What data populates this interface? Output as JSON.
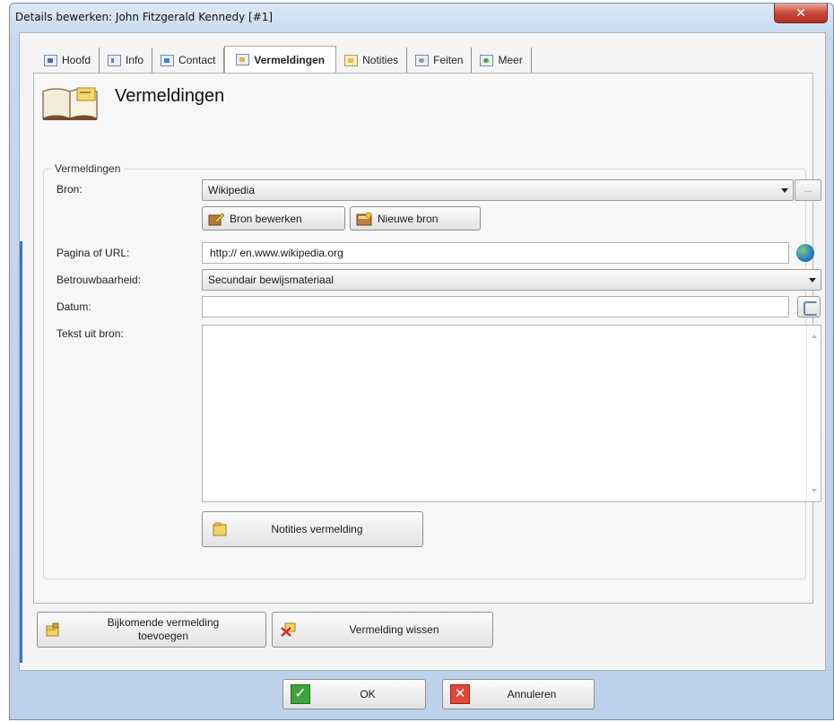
{
  "window": {
    "title": "Details bewerken: John Fitzgerald Kennedy [#1]",
    "close_glyph": "✕"
  },
  "tabs": [
    {
      "label": "Hoofd",
      "icon": "person-card-icon"
    },
    {
      "label": "Info",
      "icon": "info-icon"
    },
    {
      "label": "Contact",
      "icon": "house-icon"
    },
    {
      "label": "Vermeldingen",
      "icon": "citation-icon",
      "active": true
    },
    {
      "label": "Notities",
      "icon": "note-icon"
    },
    {
      "label": "Feiten",
      "icon": "facts-icon"
    },
    {
      "label": "Meer",
      "icon": "more-icon"
    }
  ],
  "page": {
    "heading": "Vermeldingen",
    "group_legend": "Vermeldingen"
  },
  "form": {
    "bron_label": "Bron:",
    "bron_value": "Wikipedia",
    "bron_more": "...",
    "bron_edit_button": "Bron bewerken",
    "bron_new_button": "Nieuwe bron",
    "pagina_label": "Pagina of URL:",
    "pagina_value": "http:// en.www.wikipedia.org",
    "betrouwbaarheid_label": "Betrouwbaarheid:",
    "betrouwbaarheid_value": "Secundair bewijsmateriaal",
    "datum_label": "Datum:",
    "datum_value": "",
    "tekst_label": "Tekst uit bron:",
    "tekst_value": "",
    "notities_button": "Notities vermelding"
  },
  "actions": {
    "add_line1": "Bijkomende vermelding",
    "add_line2": "toevoegen",
    "delete": "Vermelding wissen"
  },
  "footer": {
    "ok": "OK",
    "cancel": "Annuleren"
  }
}
